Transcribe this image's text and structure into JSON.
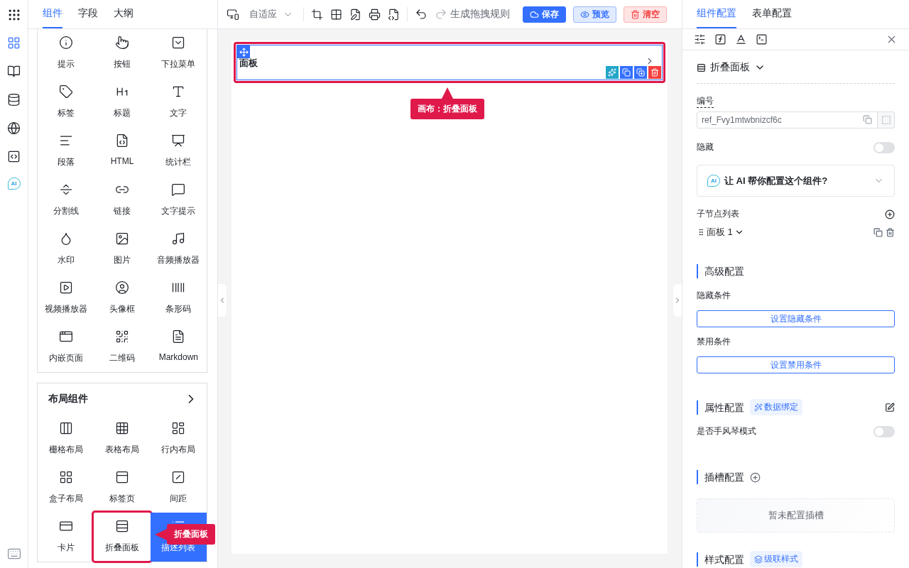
{
  "rail": [
    {
      "kind": "components",
      "selected": true
    },
    {
      "kind": "docs",
      "selected": false
    },
    {
      "kind": "data",
      "selected": false
    },
    {
      "kind": "web",
      "selected": false
    },
    {
      "kind": "code",
      "selected": false
    },
    {
      "kind": "ai",
      "label": "AI",
      "selected": false
    }
  ],
  "left_tabs": [
    {
      "label": "组件",
      "selected": true
    },
    {
      "label": "字段",
      "selected": false
    },
    {
      "label": "大纲",
      "selected": false
    }
  ],
  "basic_components": [
    {
      "label": "提示"
    },
    {
      "label": "按钮"
    },
    {
      "label": "下拉菜单"
    },
    {
      "label": "标签"
    },
    {
      "label": "标题"
    },
    {
      "label": "文字"
    },
    {
      "label": "段落"
    },
    {
      "label": "HTML"
    },
    {
      "label": "统计栏"
    },
    {
      "label": "分割线"
    },
    {
      "label": "链接"
    },
    {
      "label": "文字提示"
    },
    {
      "label": "水印"
    },
    {
      "label": "图片"
    },
    {
      "label": "音频播放器"
    },
    {
      "label": "视频播放器"
    },
    {
      "label": "头像框"
    },
    {
      "label": "条形码"
    },
    {
      "label": "内嵌页面"
    },
    {
      "label": "二维码"
    },
    {
      "label": "Markdown"
    }
  ],
  "layout_components": {
    "title": "布局组件",
    "items": [
      {
        "label": "栅格布局",
        "selected": false,
        "annotated": false
      },
      {
        "label": "表格布局",
        "selected": false,
        "annotated": false
      },
      {
        "label": "行内布局",
        "selected": false,
        "annotated": false
      },
      {
        "label": "盒子布局",
        "selected": false,
        "annotated": false
      },
      {
        "label": "标签页",
        "selected": false,
        "annotated": false
      },
      {
        "label": "间距",
        "selected": false,
        "annotated": false
      },
      {
        "label": "卡片",
        "selected": false,
        "annotated": false
      },
      {
        "label": "折叠面板",
        "selected": false,
        "annotated": true
      },
      {
        "label": "描述列表",
        "selected": true,
        "annotated": false
      }
    ]
  },
  "palette_callout": "折叠面板",
  "toolbar": {
    "device": "自适应",
    "redo_enabled": false,
    "generate": "生成拖拽规则",
    "save": "保存",
    "preview": "预览",
    "clear": "清空"
  },
  "canvas": {
    "panel_title": "面板",
    "selected": true,
    "annotated": true,
    "callout": "画布：折叠面板"
  },
  "right_tabs": [
    {
      "label": "组件配置",
      "selected": true
    },
    {
      "label": "表单配置",
      "selected": false
    }
  ],
  "component_type": "折叠面板",
  "id_field": {
    "label": "编号",
    "value": "ref_Fvy1mtwbnizcf6c"
  },
  "hidden": {
    "label": "隐藏",
    "on": false
  },
  "ai_card": {
    "badge": "AI",
    "text": "让 AI 帮你配置这个组件?"
  },
  "children": {
    "label": "子节点列表",
    "items": [
      {
        "label": "面板 1"
      }
    ]
  },
  "advanced": {
    "title": "高级配置",
    "fields": [
      {
        "label": "隐藏条件",
        "button": "设置隐藏条件"
      },
      {
        "label": "禁用条件",
        "button": "设置禁用条件"
      }
    ]
  },
  "properties": {
    "title": "属性配置",
    "tag": "数据绑定",
    "accordion": {
      "label": "是否手风琴模式",
      "on": false
    }
  },
  "slots": {
    "title": "插槽配置",
    "empty": "暂未配置插槽"
  },
  "styles": {
    "title": "样式配置",
    "tag": "级联样式"
  }
}
